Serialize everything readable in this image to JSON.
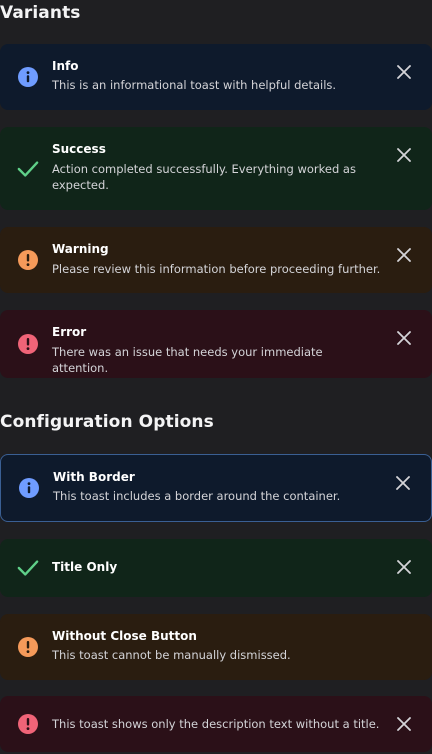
{
  "sections": {
    "variants_title": "Variants",
    "config_title": "Configuration Options"
  },
  "colors": {
    "info": "#6f9cff",
    "success": "#5fd089",
    "warning": "#f59a5a",
    "error": "#f06478"
  },
  "toasts": [
    {
      "variant": "info",
      "icon": "info-icon",
      "title": "Info",
      "description": "This is an informational toast with helpful details.",
      "closable": true
    },
    {
      "variant": "success",
      "icon": "check-icon",
      "title": "Success",
      "description": "Action completed successfully. Everything worked as expected.",
      "closable": true
    },
    {
      "variant": "warning",
      "icon": "exclamation-icon",
      "title": "Warning",
      "description": "Please review this information before proceeding further.",
      "closable": true
    },
    {
      "variant": "error",
      "icon": "exclamation-icon",
      "title": "Error",
      "description": "There was an issue that needs your immediate attention.",
      "closable": true
    },
    {
      "variant": "info",
      "icon": "info-icon",
      "title": "With Border",
      "description": "This toast includes a border around the container.",
      "closable": true,
      "bordered": true
    },
    {
      "variant": "success",
      "icon": "check-icon",
      "title": "Title Only",
      "closable": true
    },
    {
      "variant": "warning",
      "icon": "exclamation-icon",
      "title": "Without Close Button",
      "description": "This toast cannot be manually dismissed.",
      "closable": false
    },
    {
      "variant": "error",
      "icon": "exclamation-icon",
      "description": "This toast shows only the description text without a title.",
      "closable": true
    }
  ]
}
